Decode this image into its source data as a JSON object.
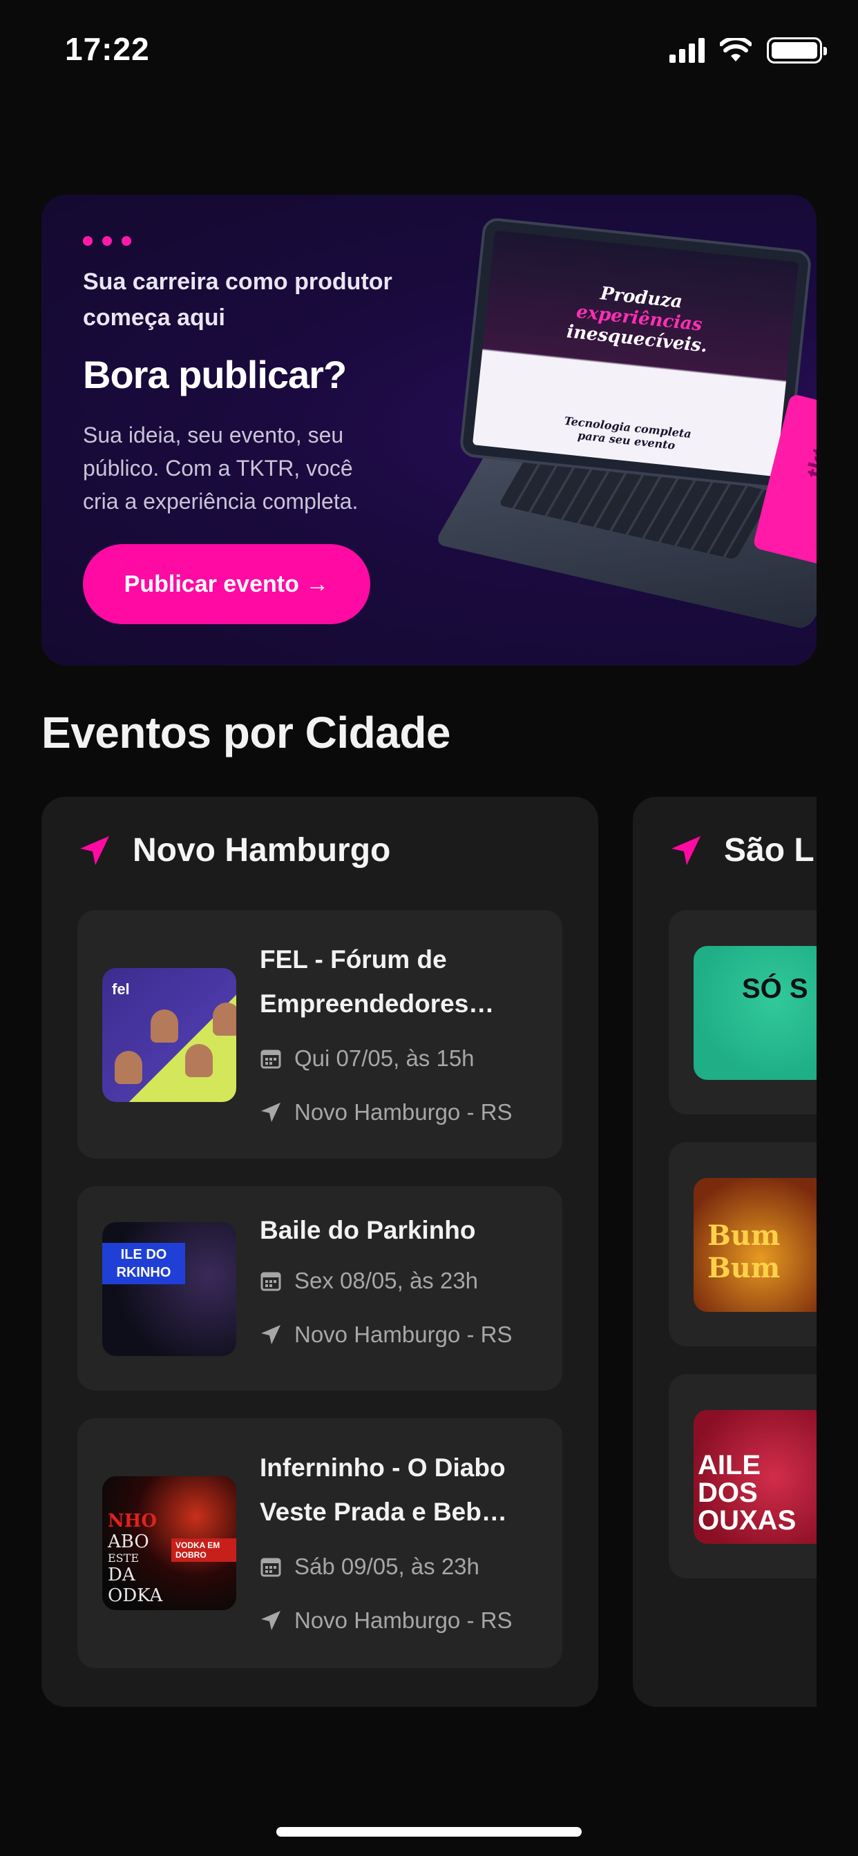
{
  "status_bar": {
    "time": "17:22"
  },
  "promo": {
    "kicker": "Sua carreira como produtor começa aqui",
    "title": "Bora publicar?",
    "description": "Sua ideia, seu evento, seu público. Com a TKTR, você cria a experiência completa.",
    "button_label": "Publicar evento →",
    "laptop_headline_1": "Produza",
    "laptop_headline_2": "experiências",
    "laptop_headline_3": "inesquecíveis.",
    "laptop_footer_1": "Tecnologia completa",
    "laptop_footer_2": "para seu evento",
    "ticket_logo": "tktr",
    "accent_color": "#ff0aa3"
  },
  "section": {
    "title": "Eventos por Cidade"
  },
  "cities": [
    {
      "name": "Novo Hamburgo",
      "events": [
        {
          "title": "FEL - Fórum de Empreendedores…",
          "date": "Qui 07/05, às 15h",
          "location": "Novo Hamburgo - RS",
          "thumb_text": "fel"
        },
        {
          "title": "Baile do Parkinho",
          "date": "Sex 08/05, às 23h",
          "location": "Novo Hamburgo - RS",
          "thumb_text": "ILE DO RKINHO"
        },
        {
          "title": "Inferninho - O Diabo Veste Prada e Beb…",
          "date": "Sáb 09/05, às 23h",
          "location": "Novo Hamburgo - RS",
          "thumb_text_1": "NHO",
          "thumb_text_2": "ABO",
          "thumb_text_3": "ESTE",
          "thumb_text_4": "DA",
          "thumb_text_5": "ODKA",
          "thumb_badge": "VODKA EM DOBRO"
        }
      ]
    },
    {
      "name": "São L",
      "events": [
        {
          "thumb_text": "SÓ S"
        },
        {
          "thumb_text": "Bum Bum"
        },
        {
          "thumb_text": "AILE DOS OUXAS"
        }
      ]
    }
  ]
}
